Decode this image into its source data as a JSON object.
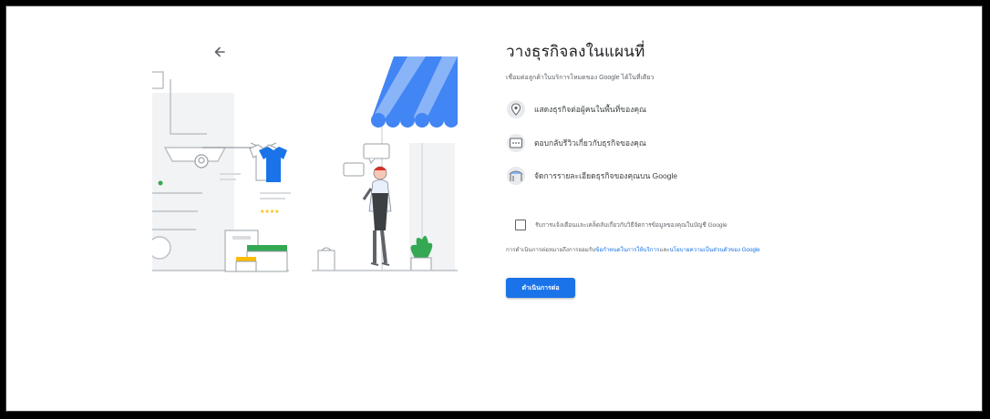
{
  "page": {
    "title": "วางธุรกิจลงในแผนที่",
    "subtitle": "เชื่อมต่อลูกค้าในบริการโหมดของ Google ได้ในที่เดียว"
  },
  "features": [
    {
      "icon": "map-pin-icon",
      "label": "แสดงธุรกิจต่อผู้คนในพื้นที่ของคุณ"
    },
    {
      "icon": "review-chat-icon",
      "label": "ตอบกลับรีวิวเกี่ยวกับธุรกิจของคุณ"
    },
    {
      "icon": "storefront-icon",
      "label": "จัดการรายละเอียดธุรกิจของคุณบน Google"
    }
  ],
  "consent": {
    "label": "รับการแจ้งเตือนและเคล็ดลับเกี่ยวกับวิธีจัดการข้อมูลของคุณในบัญชี Google",
    "checked": false
  },
  "terms": {
    "prefix": "การดำเนินการต่อหมายถึงการยอมรับ",
    "link1": "ข้อกำหนดในการให้บริการ",
    "middle": "และ",
    "link2": "นโยบายความเป็นส่วนตัวของ Google"
  },
  "buttons": {
    "continue": "ดำเนินการต่อ"
  },
  "colors": {
    "accent": "#1a73e8",
    "awning_blue": "#4285f4",
    "shirt_blue": "#1a73e8",
    "green": "#34a853",
    "yellow": "#fbbc04"
  }
}
